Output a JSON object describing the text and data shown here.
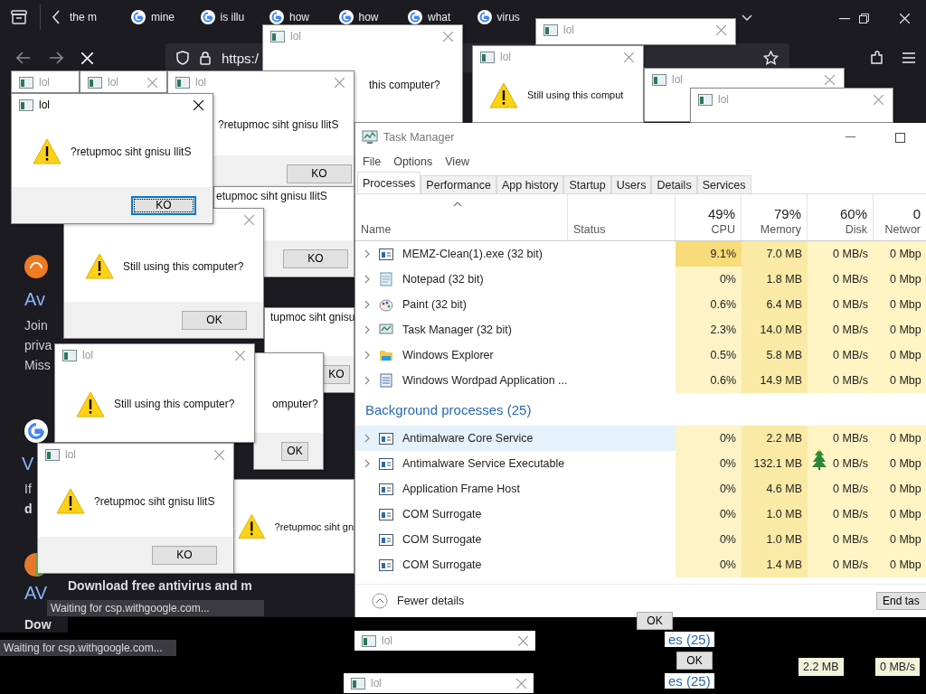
{
  "browser": {
    "tabs": [
      {
        "label": "the m",
        "kind": "plain",
        "selected": false
      },
      {
        "label": "mine",
        "kind": "google",
        "selected": false
      },
      {
        "label": "is illu",
        "kind": "google",
        "selected": false
      },
      {
        "label": "how",
        "kind": "google",
        "selected": false
      },
      {
        "label": "how",
        "kind": "google",
        "selected": false
      },
      {
        "label": "what",
        "kind": "google",
        "selected": false
      },
      {
        "label": "virus",
        "kind": "google",
        "selected": false
      }
    ],
    "address": "https:/",
    "page_texts": [
      {
        "kind": "heading",
        "text": "Av"
      },
      {
        "kind": "body",
        "text": "Join"
      },
      {
        "kind": "body",
        "text": "priva"
      },
      {
        "kind": "body",
        "text": "Miss"
      },
      {
        "kind": "heading",
        "text": "V"
      },
      {
        "kind": "body",
        "text": "If"
      },
      {
        "kind": "bold",
        "text": "d"
      },
      {
        "kind": "heading",
        "text": "AV"
      },
      {
        "kind": "bold",
        "text": "Dow"
      },
      {
        "kind": "bold",
        "text": "Download free antivirus and m"
      }
    ],
    "page_icons": [
      {
        "kind": "avast"
      },
      {
        "kind": "google"
      },
      {
        "kind": "avg"
      }
    ],
    "status_bars": [
      "Waiting for csp.withgoogle.com...",
      "Waiting for csp.withgoogle.com..."
    ]
  },
  "dialogs": [
    {
      "title": "lol",
      "active": false
    },
    {
      "title": "lol",
      "active": false
    },
    {
      "title": "lol",
      "message": "this computer?",
      "active": false
    },
    {
      "title": "lol",
      "active": false
    },
    {
      "title": "lol",
      "message": "Still using this comput",
      "warning": true,
      "active": false
    },
    {
      "title": "lol",
      "active": false
    },
    {
      "title": "lol",
      "active": false
    },
    {
      "title": "lol",
      "message": "?retupmoc siht gnisu llitS",
      "button": "KO",
      "button_focused": false,
      "active": false
    },
    {
      "message": "etupmoc siht gnisu llitS",
      "button": "KO",
      "button_focused": false
    },
    {
      "message": "Still using this computer?",
      "warning": true,
      "button": "OK",
      "button_focused": false
    },
    {
      "message": "tupmoc siht gnisu",
      "button": "KO",
      "button_focused": false
    },
    {
      "message": "omputer?",
      "button": "OK",
      "button_focused": false
    },
    {
      "title": "lol",
      "message": "Still using this computer?",
      "warning": true,
      "active": false
    },
    {
      "message": "?retupmoc siht gn",
      "warning": true
    },
    {
      "title": "lol",
      "message": "?retupmoc siht gnisu llitS",
      "warning": true,
      "button": "KO",
      "button_focused": true,
      "active": true
    },
    {
      "title": "lol",
      "message": "?retupmoc siht gnisu llitS",
      "warning": true,
      "button": "KO",
      "button_focused": false,
      "active": false
    }
  ],
  "task_manager": {
    "title": "Task Manager",
    "menu": [
      "File",
      "Options",
      "View"
    ],
    "tabs": [
      {
        "label": "Processes",
        "selected": true
      },
      {
        "label": "Performance",
        "selected": false
      },
      {
        "label": "App history",
        "selected": false
      },
      {
        "label": "Startup",
        "selected": false
      },
      {
        "label": "Users",
        "selected": false
      },
      {
        "label": "Details",
        "selected": false
      },
      {
        "label": "Services",
        "selected": false
      }
    ],
    "columns": [
      {
        "name": "Name"
      },
      {
        "name": "Status"
      },
      {
        "name": "CPU",
        "total": "49%"
      },
      {
        "name": "Memory",
        "total": "79%"
      },
      {
        "name": "Disk",
        "total": "60%"
      },
      {
        "name": "Networ",
        "total": "0"
      }
    ],
    "apps": [
      {
        "name": "MEMZ-Clean(1).exe (32 bit)",
        "kind": "app",
        "expandable": true,
        "selected": false,
        "hot": true,
        "cpu": "9.1%",
        "memory": "7.0 MB",
        "disk": "0 MB/s",
        "network": "0 Mbp"
      },
      {
        "name": "Notepad (32 bit)",
        "kind": "notepad",
        "expandable": true,
        "selected": false,
        "hot": false,
        "cpu": "0%",
        "memory": "1.8 MB",
        "disk": "0 MB/s",
        "network": "0 Mbp"
      },
      {
        "name": "Paint (32 bit)",
        "kind": "paint",
        "expandable": true,
        "selected": false,
        "hot": false,
        "cpu": "0.6%",
        "memory": "6.4 MB",
        "disk": "0 MB/s",
        "network": "0 Mbp"
      },
      {
        "name": "Task Manager (32 bit)",
        "kind": "taskmgr",
        "expandable": true,
        "selected": false,
        "hot": false,
        "cpu": "2.3%",
        "memory": "14.0 MB",
        "disk": "0 MB/s",
        "network": "0 Mbp"
      },
      {
        "name": "Windows Explorer",
        "kind": "folder",
        "expandable": true,
        "selected": false,
        "hot": false,
        "cpu": "0.5%",
        "memory": "5.8 MB",
        "disk": "0 MB/s",
        "network": "0 Mbp"
      },
      {
        "name": "Windows Wordpad Application ...",
        "kind": "wordpad",
        "expandable": true,
        "selected": false,
        "hot": false,
        "cpu": "0.6%",
        "memory": "14.9 MB",
        "disk": "0 MB/s",
        "network": "0 Mbp"
      }
    ],
    "background": {
      "heading": "Background processes (25)",
      "rows": [
        {
          "name": "Antimalware Core Service",
          "kind": "app",
          "expandable": true,
          "selected": true,
          "hot": false,
          "cpu": "0%",
          "memory": "2.2 MB",
          "disk": "0 MB/s",
          "network": "0 Mbp"
        },
        {
          "name": "Antimalware Service Executable",
          "kind": "app",
          "expandable": true,
          "selected": false,
          "hot": false,
          "cpu": "0%",
          "memory": "132.1 MB",
          "disk": "0 MB/s",
          "network": "0 Mbp"
        },
        {
          "name": "Application Frame Host",
          "kind": "app",
          "expandable": false,
          "selected": false,
          "hot": false,
          "cpu": "0%",
          "memory": "4.6 MB",
          "disk": "0 MB/s",
          "network": "0 Mbp"
        },
        {
          "name": "COM Surrogate",
          "kind": "app",
          "expandable": false,
          "selected": false,
          "hot": false,
          "cpu": "0%",
          "memory": "1.0 MB",
          "disk": "0 MB/s",
          "network": "0 Mbp"
        },
        {
          "name": "COM Surrogate",
          "kind": "app",
          "expandable": false,
          "selected": false,
          "hot": false,
          "cpu": "0%",
          "memory": "1.0 MB",
          "disk": "0 MB/s",
          "network": "0 Mbp"
        },
        {
          "name": "COM Surrogate",
          "kind": "app",
          "expandable": false,
          "selected": false,
          "hot": false,
          "cpu": "0%",
          "memory": "1.4 MB",
          "disk": "0 MB/s",
          "network": "0 Mbp"
        }
      ]
    },
    "footer": {
      "toggle": "Fewer details",
      "button": "End tas"
    }
  },
  "fragments": [
    {
      "kind": "window-title",
      "text": "lol"
    },
    {
      "kind": "window-title",
      "text": "lol"
    },
    {
      "kind": "link",
      "text": "es (25)"
    },
    {
      "kind": "link",
      "text": "es (25)"
    },
    {
      "kind": "button",
      "text": "OK"
    },
    {
      "kind": "button",
      "text": "OK"
    },
    {
      "kind": "cell",
      "text": "2.2 MB"
    },
    {
      "kind": "cell",
      "text": "0 MB/s"
    }
  ]
}
